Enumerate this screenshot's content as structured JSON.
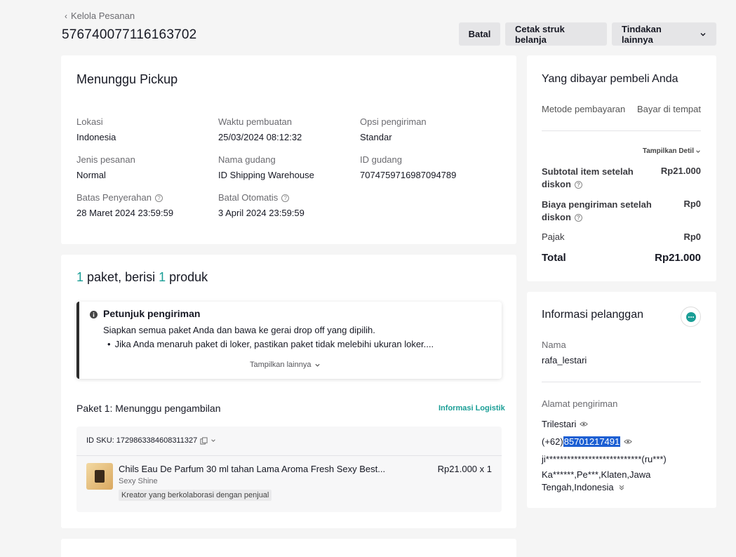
{
  "header": {
    "back_label": "Kelola Pesanan",
    "order_id": "576740077116163702",
    "actions": {
      "cancel": "Batal",
      "print": "Cetak struk belanja",
      "more": "Tindakan lainnya"
    }
  },
  "status_card": {
    "title": "Menunggu Pickup",
    "fields": [
      {
        "label": "Lokasi",
        "value": "Indonesia"
      },
      {
        "label": "Waktu pembuatan",
        "value": "25/03/2024 08:12:32"
      },
      {
        "label": "Opsi pengiriman",
        "value": "Standar"
      },
      {
        "label": "Jenis pesanan",
        "value": "Normal"
      },
      {
        "label": "Nama gudang",
        "value": "ID Shipping Warehouse"
      },
      {
        "label": "ID gudang",
        "value": "7074759716987094789"
      },
      {
        "label": "Batas Penyerahan",
        "value": "28 Maret 2024 23:59:59"
      },
      {
        "label": "Batal Otomatis",
        "value": "3 April 2024 23:59:59"
      }
    ]
  },
  "package_card": {
    "count_packages": "1",
    "text_packages": "paket, berisi",
    "count_products": "1",
    "text_products": "produk",
    "guide": {
      "title": "Petunjuk pengiriman",
      "line1": "Siapkan semua paket Anda dan bawa ke gerai drop off yang dipilih.",
      "bullet": "Jika Anda menaruh paket di loker, pastikan paket tidak melebihi ukuran loker....",
      "show_more": "Tampilkan lainnya"
    },
    "package_label": "Paket 1:",
    "package_status": "Menunggu pengambilan",
    "logistics_link": "Informasi Logistik",
    "sku_id": "ID SKU: 1729863384608311327",
    "product": {
      "name": "Chils Eau De Parfum 30 ml tahan Lama Aroma Fresh Sexy Best...",
      "variant": "Sexy Shine",
      "tag": "Kreator yang berkolaborasi dengan penjual",
      "price_qty": "Rp21.000 x 1"
    }
  },
  "payment_card": {
    "title": "Yang dibayar pembeli Anda",
    "method_label": "Metode pembayaran",
    "method_value": "Bayar di tempat",
    "details_toggle": "Tampilkan Detil",
    "rows": [
      {
        "label": "Subtotal item setelah diskon",
        "value": "Rp21.000"
      },
      {
        "label": "Biaya pengiriman setelah diskon",
        "value": "Rp0"
      },
      {
        "label": "Pajak",
        "value": "Rp0"
      }
    ],
    "total_label": "Total",
    "total_value": "Rp21.000"
  },
  "customer_card": {
    "title": "Informasi pelanggan",
    "name_label": "Nama",
    "name_value": "rafa_lestari",
    "address_label": "Alamat pengiriman",
    "recipient": "Trilestari",
    "phone_prefix": "(+62)",
    "phone_number": "85701217491",
    "street": "ji***************************(ru***)",
    "region": "Ka******,Pe***,Klaten,Jawa Tengah,Indonesia"
  },
  "colors": {
    "accent": "#1a9e96",
    "selection": "#1c5fd3"
  }
}
